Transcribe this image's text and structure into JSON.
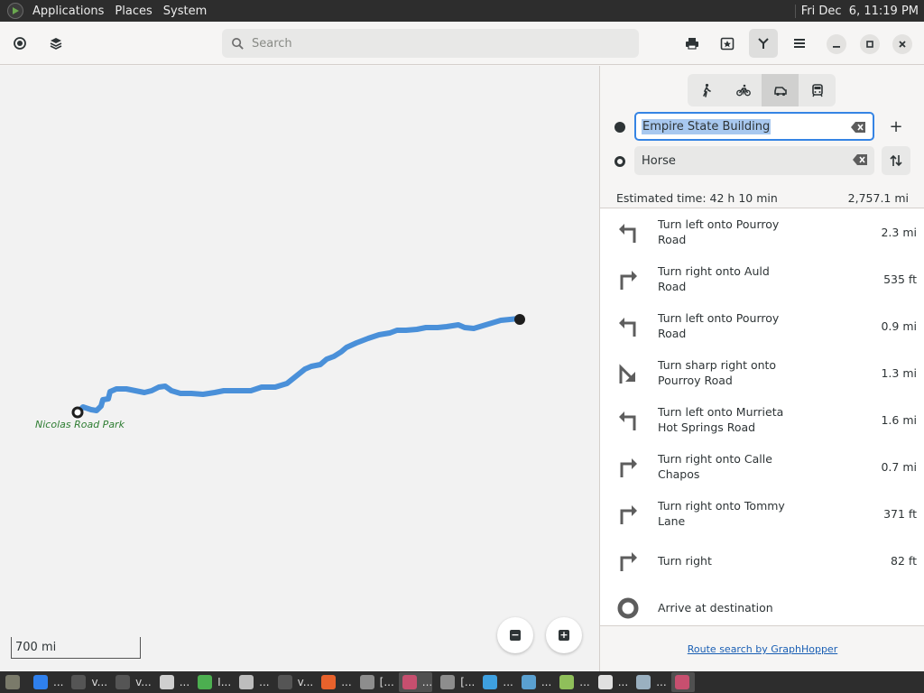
{
  "top_panel": {
    "menus": [
      "Applications",
      "Places",
      "System"
    ],
    "clock": "Fri Dec  6, 11:19 PM"
  },
  "header": {
    "search_placeholder": "Search",
    "icons": [
      "location-icon",
      "layers-icon",
      "print-icon",
      "favorites-icon",
      "route-icon",
      "hamburger-menu-icon",
      "minimize-icon",
      "maximize-icon",
      "close-icon"
    ]
  },
  "map": {
    "place_label": "Nicolas Road Park",
    "scale": "700 mi",
    "route_color": "#4a90d9"
  },
  "sidebar": {
    "modes": [
      "walk-icon",
      "bike-icon",
      "car-icon",
      "transit-icon"
    ],
    "active_mode": "car",
    "start": "Empire State Building",
    "destination": "Horse",
    "add_label": "+",
    "summary": {
      "time": "Estimated time: 42 h 10 min",
      "distance": "2,757.1 mi"
    },
    "steps": [
      {
        "icon": "turn-left",
        "text": "Turn left onto Pourroy Road",
        "dist": "2.3 mi"
      },
      {
        "icon": "turn-right",
        "text": "Turn right onto Auld Road",
        "dist": "535 ft"
      },
      {
        "icon": "turn-left",
        "text": "Turn left onto Pourroy Road",
        "dist": "0.9 mi"
      },
      {
        "icon": "sharp-right",
        "text": "Turn sharp right onto Pourroy Road",
        "dist": "1.3 mi"
      },
      {
        "icon": "turn-left",
        "text": "Turn left onto Murrieta Hot Springs Road",
        "dist": "1.6 mi"
      },
      {
        "icon": "turn-right",
        "text": "Turn right onto Calle Chapos",
        "dist": "0.7 mi"
      },
      {
        "icon": "turn-right",
        "text": "Turn right onto Tommy Lane",
        "dist": "371 ft"
      },
      {
        "icon": "turn-right",
        "text": "Turn right",
        "dist": "82 ft"
      },
      {
        "icon": "arrive",
        "text": "Arrive at destination",
        "dist": ""
      }
    ],
    "credit": "Route search by GraphHopper"
  },
  "taskbar": {
    "tasks": [
      {
        "label": "",
        "color": "#7a7a6a"
      },
      {
        "label": "...",
        "color": "#2f80ed"
      },
      {
        "label": "v...",
        "color": "#555555"
      },
      {
        "label": "v...",
        "color": "#555555"
      },
      {
        "label": "...",
        "color": "#cfcfcf"
      },
      {
        "label": "I...",
        "color": "#4caf50"
      },
      {
        "label": "...",
        "color": "#bdbdbd"
      },
      {
        "label": "v...",
        "color": "#555555"
      },
      {
        "label": "...",
        "color": "#e8622c"
      },
      {
        "label": "[...",
        "color": "#8d8d8d"
      },
      {
        "label": "...",
        "color": "#c74f6f"
      },
      {
        "label": "[...",
        "color": "#8d8d8d"
      },
      {
        "label": "...",
        "color": "#3ea0e0"
      },
      {
        "label": "...",
        "color": "#5aa0d0"
      },
      {
        "label": "...",
        "color": "#8fbf5a"
      },
      {
        "label": "...",
        "color": "#e0e0e0"
      },
      {
        "label": "...",
        "color": "#9ab0c0"
      },
      {
        "label": "",
        "color": "#c74f6f"
      }
    ]
  }
}
